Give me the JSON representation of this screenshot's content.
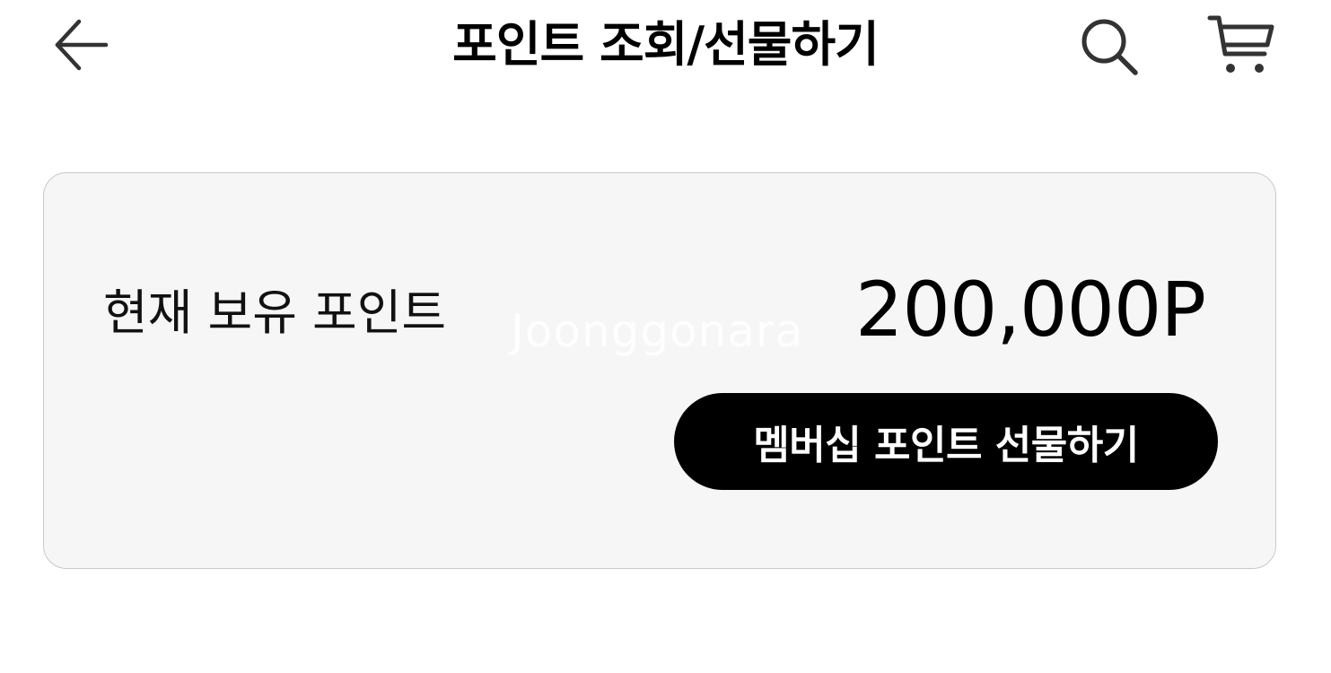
{
  "header": {
    "title": "포인트 조회/선물하기",
    "back_icon": "arrow-left-icon",
    "search_icon": "search-icon",
    "cart_icon": "cart-icon"
  },
  "points_card": {
    "label": "현재 보유 포인트",
    "value": "200,000P",
    "watermark": "Joonggonara",
    "gift_button_label": "멤버십 포인트 선물하기"
  },
  "colors": {
    "card_background": "#f6f6f6",
    "card_border": "#c9c9c9",
    "button_background": "#000000",
    "button_text": "#ffffff"
  }
}
